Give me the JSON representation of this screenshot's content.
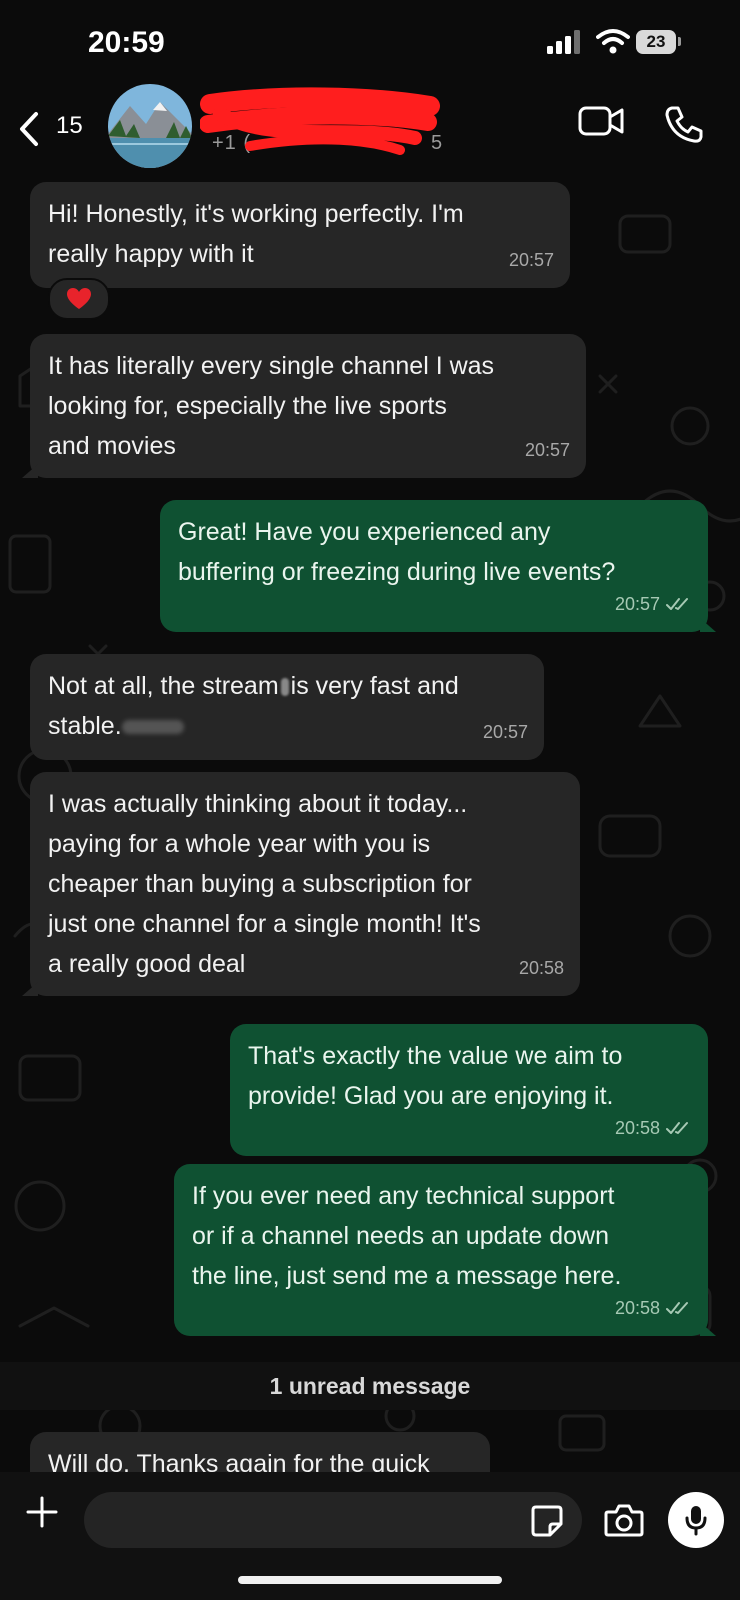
{
  "status_bar": {
    "time": "20:59",
    "battery": "23"
  },
  "header": {
    "back_count": "15",
    "contact_name": "",
    "contact_phone": "+1 (",
    "contact_phone_end": "5"
  },
  "messages": [
    {
      "direction": "in",
      "text": "Hi! Honestly, it's working perfectly. I'm\nreally happy with it",
      "time": "20:57",
      "reaction": "heart"
    },
    {
      "direction": "in",
      "text": "It has literally every single channel I was\nlooking for, especially the live sports\nand movies",
      "time": "20:57"
    },
    {
      "direction": "out",
      "text": "Great! Have you experienced any\nbuffering or freezing during live events?",
      "time": "20:57",
      "status": "read"
    },
    {
      "direction": "in",
      "text_a": "Not at all, the stream",
      "text_b": "is very fast and",
      "text_c": "stable.",
      "time": "20:57"
    },
    {
      "direction": "in",
      "text": "I was actually thinking about it today...\npaying for a whole year with you is\ncheaper than buying a subscription for\njust one channel for a single month! It's\na really good deal",
      "time": "20:58"
    },
    {
      "direction": "out",
      "text": "That's exactly the value we aim to\nprovide! Glad you are enjoying it.",
      "time": "20:58",
      "status": "read"
    },
    {
      "direction": "out",
      "text": "If you ever need any technical support\nor if a channel needs an update down\nthe line, just send me a message here.",
      "time": "20:58",
      "status": "read"
    },
    {
      "direction": "in",
      "text": "Will do. Thanks again for the quick"
    }
  ],
  "unread_label": "1 unread message",
  "composer": {
    "placeholder": ""
  },
  "icons": {
    "back": "chevron-left-icon",
    "video": "video-camera-icon",
    "call": "phone-icon",
    "plus": "plus-icon",
    "sticker": "sticker-icon",
    "camera": "camera-icon",
    "mic": "microphone-icon",
    "read": "double-check-icon",
    "reaction": "heart-icon"
  },
  "colors": {
    "background": "#0b0b0b",
    "incoming_bubble": "#262626",
    "outgoing_bubble": "#0f5132",
    "heart": "#e8232b"
  }
}
